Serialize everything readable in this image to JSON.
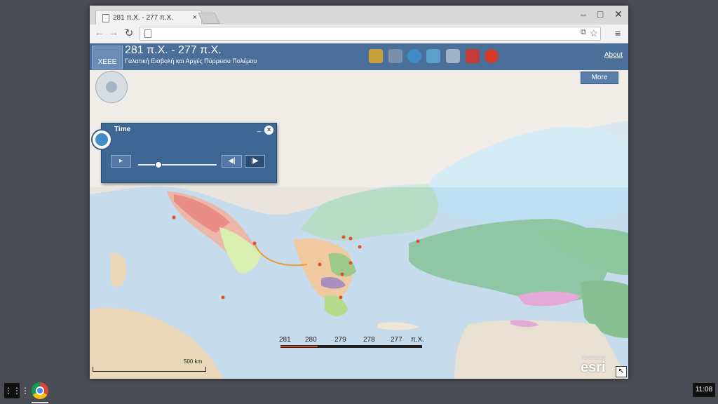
{
  "browser": {
    "tab_title": "281 π.Χ. - 277 π.Χ.",
    "tab_close": "×",
    "minimize": "–",
    "maximize": "□",
    "close": "✕",
    "back": "←",
    "forward": "→",
    "reload": "↻",
    "menu": "≡",
    "star": "☆",
    "address_value": ""
  },
  "app": {
    "title": "281 π.Χ. - 277 π.Χ.",
    "subtitle": "Γαλατική Εισβολή και  Αρχές Πύρρειου Πολέμου",
    "logo_text": "XEEE",
    "about_label": "About",
    "more_label": "More",
    "tool_colors": [
      "#c8a03a",
      "#7a8fa8",
      "#3f8cc9",
      "#5aa0c8",
      "#9fb3c8",
      "#c23b3b",
      "#d63a2a"
    ]
  },
  "time_panel": {
    "title": "Time",
    "minimize": "_",
    "close": "×",
    "play": "▸",
    "step_back": "◀|",
    "step_forward": "|▶",
    "slider_position": 0.25
  },
  "timeline": {
    "labels": [
      "281",
      "280",
      "279",
      "278",
      "277",
      "π.Χ."
    ],
    "progress": 0.26
  },
  "map": {
    "scale_label": "500 km",
    "powered_by": "POWERED BY",
    "esri": "esri",
    "resize_icon": "↖"
  },
  "shelf": {
    "launcher": "⋮⋮⋮",
    "clock": "11:08"
  }
}
